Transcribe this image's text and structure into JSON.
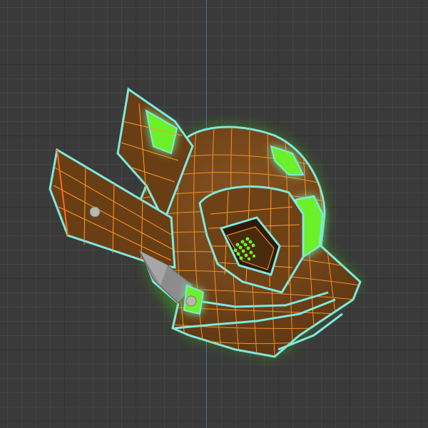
{
  "viewport": {
    "background_color": "#3a3a3a",
    "grid_minor_color": "#454545",
    "grid_major_color": "#333333",
    "axis_color": "#4d7da6"
  },
  "model": {
    "subject": "helmet-mesh",
    "shading": "wireframe-on-shaded",
    "colors": {
      "surface": "#7a4a1c",
      "wire": "#ff9a2a",
      "outline": "#7ee8e0",
      "emissive": "#6cf02a",
      "bolt": "#b8b8b0",
      "spike": "#8a8a8a"
    }
  }
}
